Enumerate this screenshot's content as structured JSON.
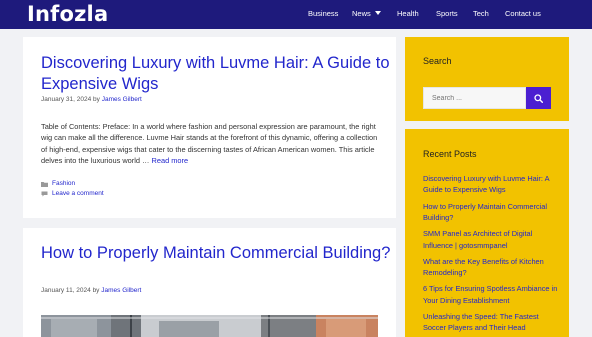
{
  "site": {
    "logo": "Infozla"
  },
  "nav": {
    "items": [
      {
        "label": "Business"
      },
      {
        "label": "News"
      },
      {
        "label": "Health"
      },
      {
        "label": "Sports"
      },
      {
        "label": "Tech"
      },
      {
        "label": "Contact us"
      }
    ]
  },
  "posts": [
    {
      "title": "Discovering Luxury with Luvme Hair: A Guide to Expensive Wigs",
      "date": "January 31, 2024",
      "by": "by",
      "author": "James Gilbert",
      "excerpt": "Table of Contents: Preface: In a world where fashion and personal expression are paramount, the right wig can make all the difference. Luvme Hair stands at the forefront of this dynamic, offering a collection of high-end, expensive wigs that cater to the discerning tastes of African American women. This article delves into the luxurious world …",
      "read_more": "Read more",
      "category": "Fashion",
      "comment_link": "Leave a comment"
    },
    {
      "title": "How to Properly Maintain Commercial Building?",
      "date": "January 11, 2024",
      "by": "by",
      "author": "James Gilbert"
    }
  ],
  "sidebar": {
    "search": {
      "title": "Search",
      "placeholder": "Search ..."
    },
    "recent": {
      "title": "Recent Posts",
      "items": [
        "Discovering Luxury with Luvme Hair: A Guide to Expensive Wigs",
        "How to Properly Maintain Commercial Building?",
        "SMM Panel as Architect of Digital Influence | gotosmmpanel",
        "What are the Key Benefits of Kitchen Remodeling?",
        "6 Tips for Ensuring Spotless Ambiance in Your Dining Establishment",
        "Unleashing the Speed: The Fastest Soccer Players and Their Head"
      ]
    }
  },
  "colors": {
    "header_bg": "#1e1a7c",
    "link": "#2226cc",
    "widget_bg": "#f2c200",
    "search_button": "#4b1fd1",
    "page_bg": "#f1f2f5"
  },
  "icons": {
    "nav_dropdown": "caret-down-icon",
    "category": "folder-icon",
    "comment": "comment-icon",
    "search": "search-icon"
  }
}
